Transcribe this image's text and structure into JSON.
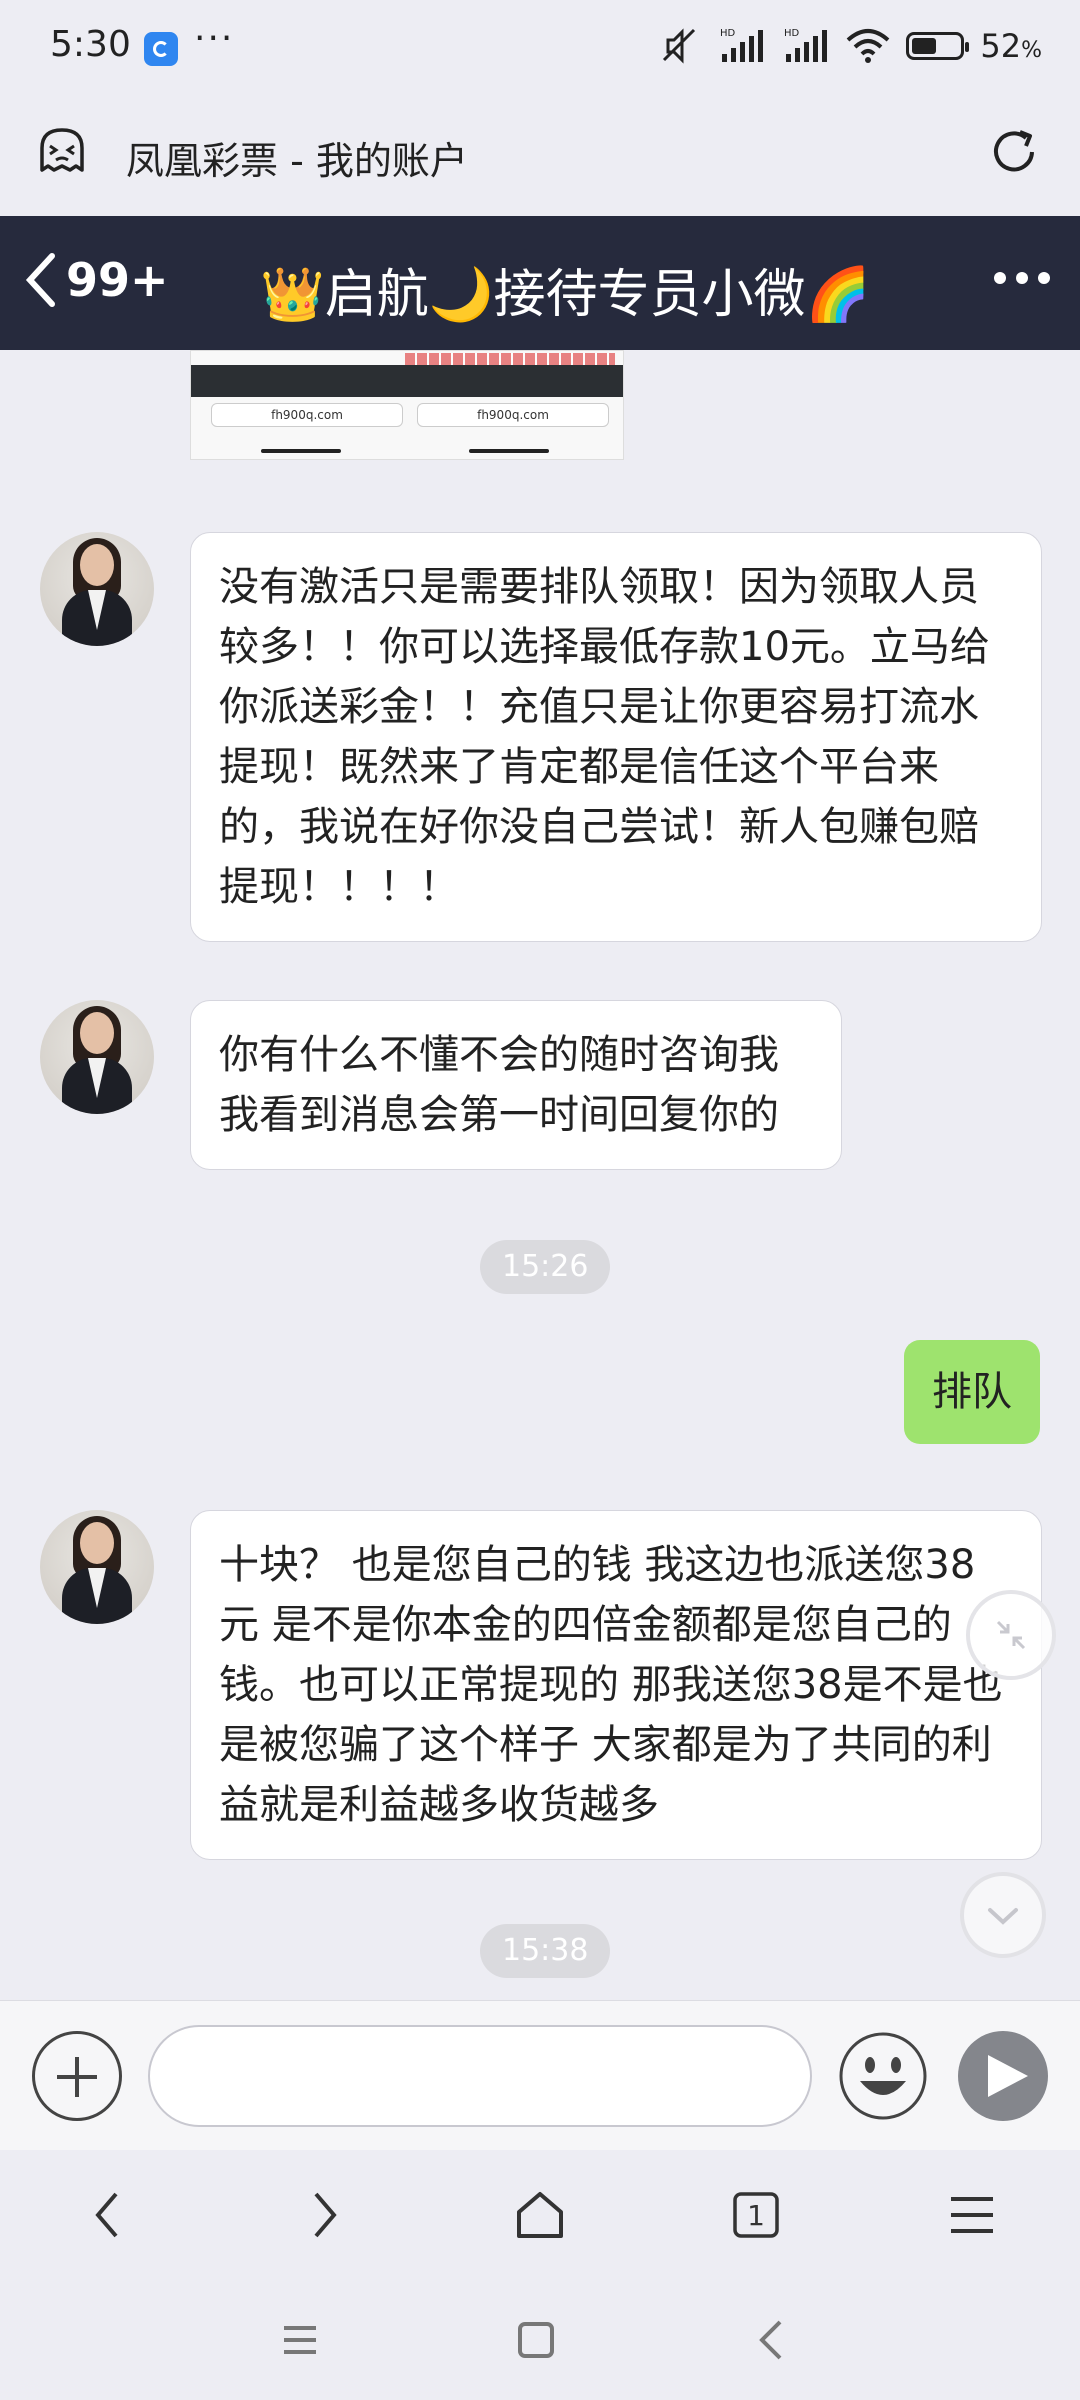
{
  "status": {
    "time": "5:30",
    "dots": "···",
    "battery_pct": "52",
    "battery_unit": "%"
  },
  "browser": {
    "title": "凤凰彩票 - 我的账户"
  },
  "chat_header": {
    "back_count": "99+",
    "title": "👑启航🌙接待专员小微🌈"
  },
  "preview_image": {
    "url": "fh900q.com"
  },
  "messages": [
    {
      "side": "left",
      "text": "没有激活只是需要排队领取！因为领取人员较多！！你可以选择最低存款10元。立马给你派送彩金！！充值只是让你更容易打流水提现！既然来了肯定都是信任这个平台来的，我说在好你没自己尝试！新人包赚包赔提现！！！！"
    },
    {
      "side": "left",
      "text": "你有什么不懂不会的随时咨询我我看到消息会第一时间回复你的"
    },
    {
      "side": "time",
      "text": "15:26"
    },
    {
      "side": "right",
      "text": "排队"
    },
    {
      "side": "left",
      "text": "十块？ 也是您自己的钱 我这边也派送您38元 是不是你本金的四倍金额都是您自己的钱。也可以正常提现的 那我送您38是不是也是被您骗了这个样子 大家都是为了共同的利益就是利益越多收货越多"
    },
    {
      "side": "time",
      "text": "15:38"
    }
  ],
  "input": {
    "placeholder": ""
  },
  "browser_nav": {
    "tab_count": "1"
  }
}
